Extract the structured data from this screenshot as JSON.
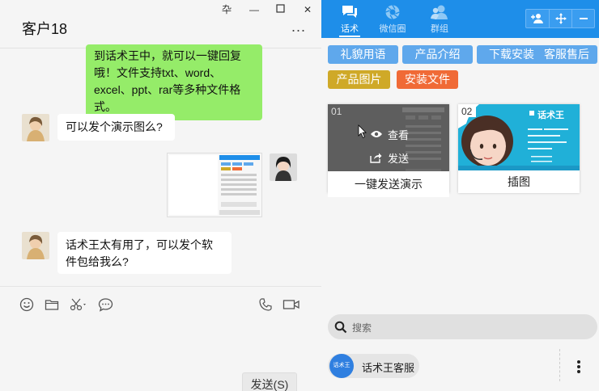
{
  "window": {
    "pin_glyph": "卆",
    "minimize_glyph": "—",
    "maximize_glyph": "☐",
    "close_glyph": "✕"
  },
  "chat": {
    "title": "客户18",
    "more_glyph": "...",
    "messages": [
      {
        "side": "right",
        "type": "text",
        "text": "到话术王中，就可以一键回复哦！文件支持txt、word、excel、ppt、rar等多种文件格式。"
      },
      {
        "side": "left",
        "type": "text",
        "text": "可以发个演示图么?"
      },
      {
        "side": "right",
        "type": "image"
      },
      {
        "side": "left",
        "type": "text",
        "text": "话术王太有用了，可以发个软件包给我么?"
      }
    ],
    "send_label": "发送(S)"
  },
  "panel": {
    "tabs": [
      {
        "label": "话术",
        "icon": "chat-icon",
        "active": true
      },
      {
        "label": "微信圈",
        "icon": "aperture-icon",
        "active": false
      },
      {
        "label": "群组",
        "icon": "group-icon",
        "active": false
      }
    ],
    "categories": [
      {
        "label": "礼貌用语",
        "color": "#5fa8ec"
      },
      {
        "label": "产品介绍",
        "color": "#5fa8ec"
      },
      {
        "label": "下载安装",
        "color": "#5fa8ec"
      },
      {
        "label": "客服售后",
        "color": "#5fa8ec"
      },
      {
        "label": "产品图片",
        "color": "#cfa928"
      },
      {
        "label": "安装文件",
        "color": "#f06a36"
      }
    ],
    "cards": [
      {
        "number": "01",
        "caption": "一键发送演示",
        "overlay": {
          "view_label": "查看",
          "send_label": "发送"
        }
      },
      {
        "number": "02",
        "caption": "插图",
        "brand": "话术王"
      }
    ],
    "search_placeholder": "搜索",
    "account": {
      "name": "话术王客服",
      "avatar_text": "话术王"
    }
  },
  "colors": {
    "accent": "#1e8ee9",
    "bubble_green": "#95ec69"
  }
}
